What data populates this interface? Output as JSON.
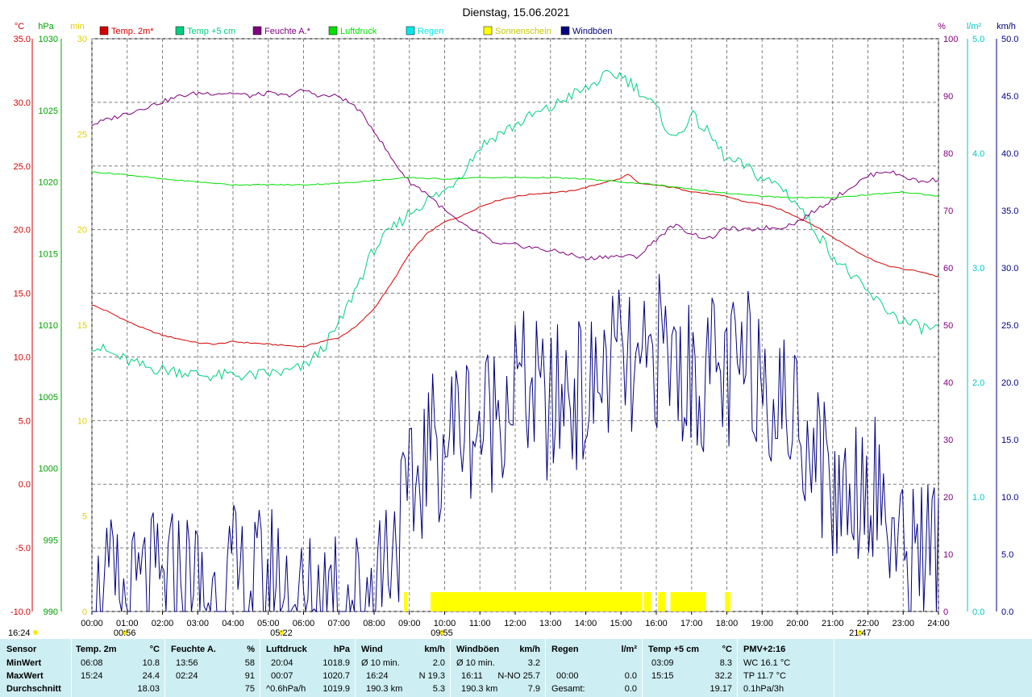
{
  "chart_data": {
    "type": "line",
    "title": "Dienstag, 15.06.2021",
    "x_ticks": [
      "00:00",
      "01:00",
      "02:00",
      "03:00",
      "04:00",
      "05:00",
      "06:00",
      "07:00",
      "08:00",
      "09:00",
      "10:00",
      "11:00",
      "12:00",
      "13:00",
      "14:00",
      "15:00",
      "16:00",
      "17:00",
      "18:00",
      "19:00",
      "20:00",
      "21:00",
      "22:00",
      "23:00",
      "24:00"
    ],
    "axes": {
      "temp": {
        "unit": "°C",
        "color": "#d40000",
        "min": -10,
        "max": 35,
        "ticks": [
          "35.0",
          "30.0",
          "25.0",
          "20.0",
          "15.0",
          "10.0",
          "5.0",
          "0.0",
          "-5.0",
          "-10.0"
        ]
      },
      "press": {
        "unit": "hPa",
        "color": "#00a000",
        "min": 990,
        "max": 1030,
        "ticks": [
          "1030",
          "1025",
          "1020",
          "1015",
          "1010",
          "1005",
          "1000",
          "995",
          "990"
        ]
      },
      "sun": {
        "unit": "min",
        "color": "#e0d000",
        "min": 0,
        "max": 30,
        "ticks": [
          "30",
          "25",
          "20",
          "15",
          "10",
          "5",
          "0"
        ]
      },
      "hum": {
        "unit": "%",
        "color": "#800080",
        "min": 0,
        "max": 100,
        "ticks": [
          "100",
          "90",
          "80",
          "70",
          "60",
          "50",
          "40",
          "30",
          "20",
          "10",
          "0"
        ]
      },
      "rain": {
        "unit": "l/m²",
        "color": "#00c8c8",
        "min": 0,
        "max": 5,
        "ticks": [
          "5.0",
          "4.0",
          "3.0",
          "2.0",
          "1.0",
          "0.0"
        ]
      },
      "wind": {
        "unit": "km/h",
        "color": "#000080",
        "min": 0,
        "max": 50,
        "ticks": [
          "50.0",
          "45.0",
          "40.0",
          "35.0",
          "30.0",
          "25.0",
          "20.0",
          "15.0",
          "10.0",
          "5.0",
          "0.0"
        ]
      }
    },
    "legend": [
      {
        "label": "Temp. 2m*",
        "color": "#d40000"
      },
      {
        "label": "Temp +5 cm",
        "color": "#00d080"
      },
      {
        "label": "Feuchte A.*",
        "color": "#800080"
      },
      {
        "label": "Luftdruck",
        "color": "#00e000"
      },
      {
        "label": "Regen",
        "color": "#00e8e8"
      },
      {
        "label": "Sonnenschein",
        "color": "#ffff00"
      },
      {
        "label": "Windböen",
        "color": "#000080"
      }
    ],
    "series": [
      {
        "name": "Temp. 2m*",
        "axis": "temp",
        "color": "#d40000",
        "x": [
          0,
          0.5,
          1,
          1.5,
          2,
          2.5,
          3,
          3.5,
          4,
          4.5,
          5,
          5.5,
          6,
          6.5,
          7,
          7.5,
          8,
          8.5,
          9,
          9.5,
          10,
          10.5,
          11,
          11.5,
          12,
          12.5,
          13,
          13.5,
          14,
          14.5,
          15,
          15.2,
          15.5,
          16,
          16.5,
          17,
          17.5,
          18,
          18.5,
          19,
          19.5,
          20,
          20.5,
          21,
          21.5,
          22,
          22.5,
          23,
          23.5,
          24
        ],
        "y": [
          14.1,
          13.5,
          12.8,
          12.2,
          11.7,
          11.4,
          11.1,
          11.0,
          11.2,
          11.1,
          11.0,
          10.9,
          10.8,
          11.2,
          11.5,
          12.4,
          13.8,
          15.8,
          18.1,
          19.7,
          20.6,
          21.1,
          21.8,
          22.3,
          22.6,
          22.8,
          22.9,
          23.0,
          23.3,
          23.7,
          24.0,
          24.4,
          23.6,
          23.5,
          23.3,
          23.0,
          22.8,
          22.6,
          22.2,
          22.0,
          21.6,
          21.0,
          20.3,
          19.4,
          18.6,
          17.8,
          17.2,
          16.9,
          16.7,
          16.3
        ]
      },
      {
        "name": "Temp +5 cm",
        "axis": "temp",
        "color": "#00d080",
        "x": [
          0,
          0.5,
          1,
          1.5,
          2,
          2.5,
          3,
          3.5,
          4,
          4.5,
          5,
          5.5,
          6,
          6.5,
          7,
          7.5,
          8,
          8.5,
          9,
          9.5,
          10,
          10.5,
          11,
          11.5,
          12,
          12.5,
          13,
          13.5,
          14,
          14.5,
          15,
          15.5,
          16,
          16.5,
          17,
          17.5,
          18,
          18.5,
          19,
          19.5,
          20,
          20.5,
          21,
          21.5,
          22,
          22.5,
          23,
          23.5,
          24
        ],
        "y": [
          11.0,
          10.3,
          9.7,
          9.2,
          9.0,
          8.9,
          8.6,
          8.5,
          8.6,
          8.5,
          8.7,
          8.8,
          9.2,
          10.5,
          12.5,
          15.5,
          18.5,
          20.0,
          21.3,
          22.3,
          23.0,
          24.5,
          26.5,
          27.5,
          28.2,
          29.0,
          29.5,
          30.5,
          31.0,
          32.0,
          32.2,
          31.0,
          29.5,
          27.0,
          29.0,
          27.5,
          25.5,
          25.0,
          24.0,
          23.5,
          22.0,
          20.0,
          18.0,
          16.5,
          15.0,
          13.8,
          12.8,
          12.3,
          12.2
        ]
      },
      {
        "name": "Feuchte A.*",
        "axis": "hum",
        "color": "#800080",
        "x": [
          0,
          0.5,
          1,
          1.5,
          2,
          2.5,
          3,
          3.5,
          4,
          4.5,
          5,
          5.5,
          6,
          6.5,
          7,
          7.5,
          8,
          8.5,
          9,
          9.5,
          10,
          10.5,
          11,
          11.5,
          12,
          12.5,
          13,
          13.5,
          14,
          14.5,
          15,
          15.5,
          16,
          16.5,
          17,
          17.5,
          18,
          18.5,
          19,
          19.5,
          20,
          20.5,
          21,
          21.5,
          22,
          22.5,
          23,
          23.5,
          24
        ],
        "y": [
          85,
          86,
          87,
          88,
          89,
          90,
          90.5,
          90.5,
          90.5,
          90,
          90.5,
          90,
          91,
          90,
          90,
          88,
          84,
          79,
          75,
          73,
          70,
          67.5,
          66,
          64,
          64,
          63.5,
          63,
          62.5,
          61.5,
          62,
          62,
          62,
          65,
          67.5,
          66,
          65,
          67,
          66.5,
          67,
          67,
          68,
          70,
          72,
          74,
          76,
          77,
          76,
          75,
          75.5
        ]
      },
      {
        "name": "Luftdruck",
        "axis": "press",
        "color": "#00e000",
        "x": [
          0,
          1,
          2,
          3,
          4,
          5,
          6,
          7,
          8,
          9,
          10,
          11,
          12,
          13,
          14,
          15,
          16,
          17,
          18,
          19,
          20,
          21,
          22,
          23,
          24
        ],
        "y": [
          1020.7,
          1020.5,
          1020.2,
          1020.0,
          1019.8,
          1019.8,
          1019.8,
          1019.9,
          1020.1,
          1020.3,
          1020.2,
          1020.3,
          1020.3,
          1020.3,
          1020.2,
          1020.0,
          1019.8,
          1019.5,
          1019.2,
          1019.0,
          1018.9,
          1018.9,
          1019.1,
          1019.3,
          1019.0
        ]
      },
      {
        "name": "Windböen",
        "axis": "wind",
        "color": "#000080",
        "x": [
          0,
          0.5,
          1,
          1.5,
          2,
          2.5,
          3,
          3.5,
          4,
          4.5,
          5,
          5.5,
          6,
          6.5,
          7,
          7.5,
          8,
          8.5,
          9,
          9.5,
          10,
          10.5,
          11,
          11.5,
          12,
          12.5,
          13,
          13.5,
          14,
          14.5,
          15,
          15.5,
          16,
          16.5,
          17,
          17.5,
          18,
          18.5,
          19,
          19.5,
          20,
          20.5,
          21,
          21.5,
          22,
          22.5,
          23,
          23.5,
          24
        ],
        "y": [
          0,
          1.5,
          0,
          2,
          1.5,
          3,
          2,
          1,
          2.5,
          1.5,
          3,
          1.5,
          0,
          1.5,
          2.5,
          1,
          3,
          6.5,
          9,
          14,
          15,
          17,
          16,
          18,
          20,
          19,
          17,
          20,
          18,
          21,
          22,
          19,
          23,
          22,
          20,
          21,
          20,
          21,
          22,
          18,
          17,
          15,
          10,
          11,
          12,
          9,
          4,
          6,
          5
        ]
      },
      {
        "name": "Sonnenschein",
        "axis": "sun",
        "color": "#ffff00",
        "segments": [
          [
            8.85,
            8.95
          ],
          [
            9.6,
            15.6
          ],
          [
            15.65,
            15.85
          ],
          [
            16.05,
            16.25
          ],
          [
            16.4,
            17.4
          ],
          [
            17.95,
            18.1
          ]
        ]
      }
    ],
    "markers": [
      {
        "time": 0.93,
        "label": "00:56"
      },
      {
        "time": 5.37,
        "label": "05:22"
      },
      {
        "time": 9.92,
        "label": "09:55"
      },
      {
        "time": 21.78,
        "label": "21:47"
      }
    ],
    "corner_label": "16:24"
  },
  "stats": {
    "sensor": {
      "header": "Sensor",
      "rows": [
        "MinWert",
        "MaxWert",
        "Durchschnitt"
      ]
    },
    "temp2m": {
      "header": "Temp. 2m",
      "unit": "°C",
      "min_time": "06:08",
      "min": "10.8",
      "max_time": "15:24",
      "max": "24.4",
      "avg": "18.03"
    },
    "hum": {
      "header": "Feuchte A.",
      "unit": "%",
      "min_time": "13:56",
      "min": "58",
      "max_time": "02:24",
      "max": "91",
      "avg": "75"
    },
    "press": {
      "header": "Luftdruck",
      "unit": "hPa",
      "min_time": "20:04",
      "min": "1018.9",
      "max_time": "00:07",
      "max": "1020.7",
      "avg_left": "^0.6hPa/h",
      "avg": "1019.9"
    },
    "wind": {
      "header": "Wind",
      "unit": "km/h",
      "r1_left": "Ø 10 min.",
      "r1": "2.0",
      "r2_left": "16:24",
      "r2_mid": "N 19.3",
      "r3_left": "190.3 km",
      "r3": "5.3"
    },
    "gusts": {
      "header": "Windböen",
      "unit": "km/h",
      "r1_left": "Ø 10 min.",
      "r1": "3.2",
      "r2_left": "16:11",
      "r2_mid": "N-NO 25.7",
      "r3_left": "190.3 km",
      "r3": "7.9"
    },
    "rain": {
      "header": "Regen",
      "unit": "l/m²",
      "r2_left": "00:00",
      "r2": "0.0",
      "r3_left": "Gesamt:",
      "r3": "0.0"
    },
    "temp5": {
      "header": "Temp +5 cm",
      "unit": "°C",
      "min_time": "03:09",
      "min": "8.3",
      "max_time": "15:15",
      "max": "32.2",
      "avg": "19.17"
    },
    "pmv": {
      "header": "PMV+2:16",
      "r1": "WC 16.1 °C",
      "r2": "TP 11.7 °C",
      "r3": "0.1hPa/3h"
    }
  }
}
